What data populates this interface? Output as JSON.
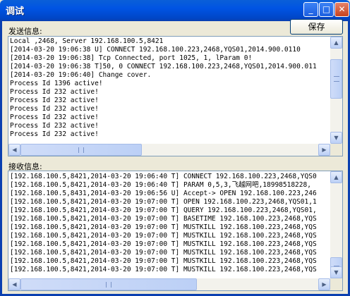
{
  "window": {
    "title": "调试",
    "min_glyph": "_",
    "max_glyph": "□",
    "close_glyph": "✕"
  },
  "send": {
    "label": "发送信息:",
    "save_label": "保存",
    "lines": [
      "Local ,2468, Server 192.168.100.5,8421",
      "[2014-03-20 19:06:38 U] CONNECT 192.168.100.223,2468,YQS01,2014.900.0110",
      "[2014-03-20 19:06:38] Tcp Connected, port 1025, 1, lParam 0!",
      "[2014-03-20 19:06:38 T]50, 0 CONNECT 192.168.100.223,2468,YQS01,2014.900.011",
      "[2014-03-20 19:06:40] Change cover.",
      "Process Id 1396 active!",
      "Process Id 232 active!",
      "Process Id 232 active!",
      "Process Id 232 active!",
      "Process Id 232 active!",
      "Process Id 232 active!",
      "Process Id 232 active!"
    ]
  },
  "recv": {
    "label": "接收信息:",
    "lines": [
      "[192.168.100.5,8421,2014-03-20 19:06:40 T] CONNECT 192.168.100.223,2468,YQS0",
      "[192.168.100.5,8421,2014-03-20 19:06:40 T] PARAM 0,5,3,飞越网吧,18998518228,",
      "[192.168.100.5,8431,2014-03-20 19:06:56 U] Accept-> OPEN 192.168.100.223,246",
      "[192.168.100.5,8421,2014-03-20 19:07:00 T] OPEN 192.168.100.223,2468,YQS01,1",
      "[192.168.100.5,8421,2014-03-20 19:07:00 T] QUERY 192.168.100.223,2468,YQS01,",
      "[192.168.100.5,8421,2014-03-20 19:07:00 T] BASETIME 192.168.100.223,2468,YQS",
      "[192.168.100.5,8421,2014-03-20 19:07:00 T] MUSTKILL 192.168.100.223,2468,YQS",
      "[192.168.100.5,8421,2014-03-20 19:07:00 T] MUSTKILL 192.168.100.223,2468,YQS",
      "[192.168.100.5,8421,2014-03-20 19:07:00 T] MUSTKILL 192.168.100.223,2468,YQS",
      "[192.168.100.5,8421,2014-03-20 19:07:00 T] MUSTKILL 192.168.100.223,2468,YQS",
      "[192.168.100.5,8421,2014-03-20 19:07:00 T] MUSTKILL 192.168.100.223,2468,YQS",
      "[192.168.100.5,8421,2014-03-20 19:07:00 T] MUSTKILL 192.168.100.223,2468,YQS"
    ]
  },
  "icons": {
    "scroll_up": "chevron-up-icon",
    "scroll_down": "chevron-down-icon",
    "scroll_left": "chevron-left-icon",
    "scroll_right": "chevron-right-icon"
  },
  "colors": {
    "titlebar": "#0054e3",
    "background": "#ece9d8",
    "close_button": "#c7421f"
  }
}
